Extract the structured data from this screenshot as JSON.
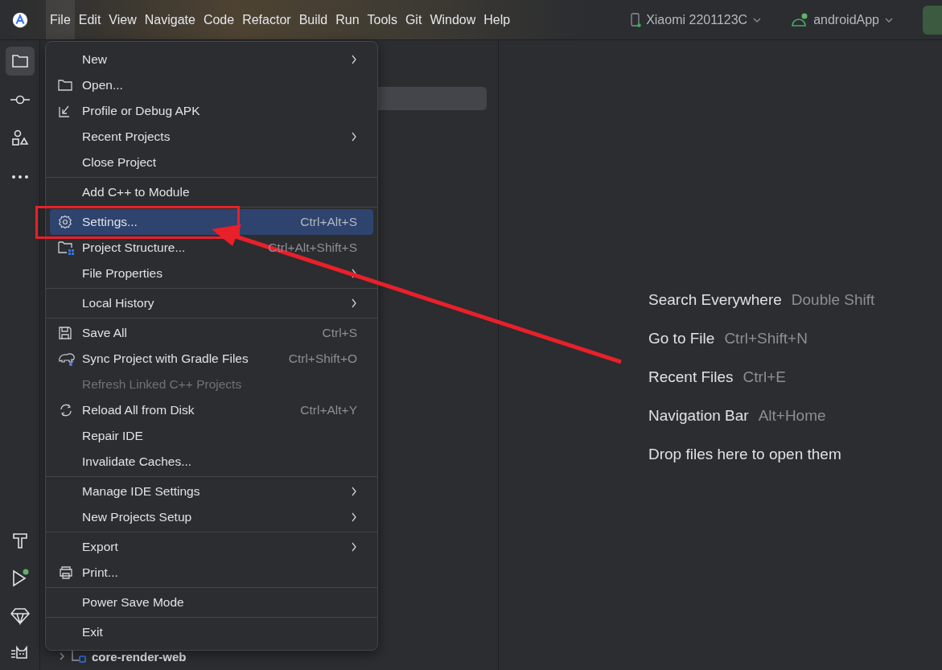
{
  "menu_bar": [
    {
      "label": "File",
      "selected": true
    },
    {
      "label": "Edit",
      "selected": false
    },
    {
      "label": "View",
      "selected": false
    },
    {
      "label": "Navigate",
      "selected": false
    },
    {
      "label": "Code",
      "selected": false
    },
    {
      "label": "Refactor",
      "selected": false
    },
    {
      "label": "Build",
      "selected": false
    },
    {
      "label": "Run",
      "selected": false
    },
    {
      "label": "Tools",
      "selected": false
    },
    {
      "label": "Git",
      "selected": false
    },
    {
      "label": "Window",
      "selected": false
    },
    {
      "label": "Help",
      "selected": false
    }
  ],
  "device": {
    "name": "Xiaomi 2201123C"
  },
  "run_config": {
    "name": "androidApp"
  },
  "tool_strip": [
    {
      "selected": true
    },
    {
      "selected": false
    },
    {
      "selected": false
    },
    {
      "selected": false
    }
  ],
  "file_menu": [
    [
      {
        "label": "New",
        "has_submenu": true,
        "selected": false,
        "disabled": false,
        "annotated": false
      },
      {
        "label": "Open...",
        "has_submenu": false,
        "selected": false,
        "disabled": false,
        "annotated": false
      },
      {
        "label": "Profile or Debug APK",
        "has_submenu": false,
        "selected": false,
        "disabled": false,
        "annotated": false
      },
      {
        "label": "Recent Projects",
        "has_submenu": true,
        "selected": false,
        "disabled": false,
        "annotated": false
      },
      {
        "label": "Close Project",
        "has_submenu": false,
        "selected": false,
        "disabled": false,
        "annotated": false
      }
    ],
    [
      {
        "label": "Add C++ to Module",
        "has_submenu": false,
        "selected": false,
        "disabled": false,
        "annotated": false
      }
    ],
    [
      {
        "label": "Settings...",
        "shortcut": "Ctrl+Alt+S",
        "has_submenu": false,
        "selected": true,
        "disabled": false,
        "annotated": true
      },
      {
        "label": "Project Structure...",
        "shortcut": "Ctrl+Alt+Shift+S",
        "has_submenu": false,
        "selected": false,
        "disabled": false,
        "annotated": false
      },
      {
        "label": "File Properties",
        "has_submenu": true,
        "selected": false,
        "disabled": false,
        "annotated": false
      }
    ],
    [
      {
        "label": "Local History",
        "has_submenu": true,
        "selected": false,
        "disabled": false,
        "annotated": false
      }
    ],
    [
      {
        "label": "Save All",
        "shortcut": "Ctrl+S",
        "has_submenu": false,
        "selected": false,
        "disabled": false,
        "annotated": false
      },
      {
        "label": "Sync Project with Gradle Files",
        "shortcut": "Ctrl+Shift+O",
        "has_submenu": false,
        "selected": false,
        "disabled": false,
        "annotated": false
      },
      {
        "label": "Refresh Linked C++ Projects",
        "has_submenu": false,
        "selected": false,
        "disabled": true,
        "annotated": false
      },
      {
        "label": "Reload All from Disk",
        "shortcut": "Ctrl+Alt+Y",
        "has_submenu": false,
        "selected": false,
        "disabled": false,
        "annotated": false
      },
      {
        "label": "Repair IDE",
        "has_submenu": false,
        "selected": false,
        "disabled": false,
        "annotated": false
      },
      {
        "label": "Invalidate Caches...",
        "has_submenu": false,
        "selected": false,
        "disabled": false,
        "annotated": false
      }
    ],
    [
      {
        "label": "Manage IDE Settings",
        "has_submenu": true,
        "selected": false,
        "disabled": false,
        "annotated": false
      },
      {
        "label": "New Projects Setup",
        "has_submenu": true,
        "selected": false,
        "disabled": false,
        "annotated": false
      }
    ],
    [
      {
        "label": "Export",
        "has_submenu": true,
        "selected": false,
        "disabled": false,
        "annotated": false
      },
      {
        "label": "Print...",
        "has_submenu": false,
        "selected": false,
        "disabled": false,
        "annotated": false
      }
    ],
    [
      {
        "label": "Power Save Mode",
        "has_submenu": false,
        "selected": false,
        "disabled": false,
        "annotated": false
      }
    ],
    [
      {
        "label": "Exit",
        "has_submenu": false,
        "selected": false,
        "disabled": false,
        "annotated": false
      }
    ]
  ],
  "project_tree": [
    {
      "label": "core-render-web",
      "expanded": false
    }
  ],
  "hints": [
    {
      "action": "Search Everywhere",
      "shortcut": "Double Shift"
    },
    {
      "action": "Go to File",
      "shortcut": "Ctrl+Shift+N"
    },
    {
      "action": "Recent Files",
      "shortcut": "Ctrl+E"
    },
    {
      "action": "Navigation Bar",
      "shortcut": "Alt+Home"
    },
    {
      "action": "Drop files here to open them"
    }
  ]
}
